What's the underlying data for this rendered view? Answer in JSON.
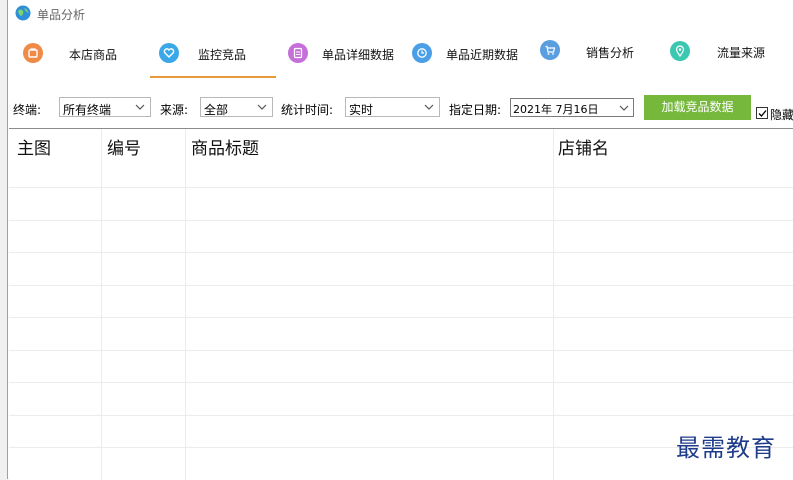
{
  "window": {
    "title": "单品分析"
  },
  "tabs": [
    {
      "label": "本店商品",
      "icon": "store-icon",
      "color": "#f08a47",
      "active": false
    },
    {
      "label": "监控竞品",
      "icon": "heart-icon",
      "color": "#3aa8e8",
      "active": true
    },
    {
      "label": "单品详细数据",
      "icon": "document-icon",
      "color": "#c56fd8",
      "active": false
    },
    {
      "label": "单品近期数据",
      "icon": "clock-icon",
      "color": "#4a9fe6",
      "active": false
    },
    {
      "label": "销售分析",
      "icon": "cart-icon",
      "color": "#5b9ee0",
      "active": false
    },
    {
      "label": "流量来源",
      "icon": "location-icon",
      "color": "#3cc7b0",
      "active": false
    }
  ],
  "filters": {
    "terminal_label": "终端:",
    "terminal_value": "所有终端",
    "source_label": "来源:",
    "source_value": "全部",
    "time_label": "统计时间:",
    "time_value": "实时",
    "date_label": "指定日期:",
    "date_value": "2021年  7月16日",
    "load_button": "加载竞品数据",
    "hide_checkbox_label": "隐藏",
    "hide_checked": true
  },
  "table": {
    "columns": [
      "主图",
      "编号",
      "商品标题",
      "店铺名"
    ],
    "rows": []
  },
  "watermark": "最需教育",
  "colors": {
    "accent_underline": "#e69a3a",
    "load_button": "#76b83c"
  }
}
